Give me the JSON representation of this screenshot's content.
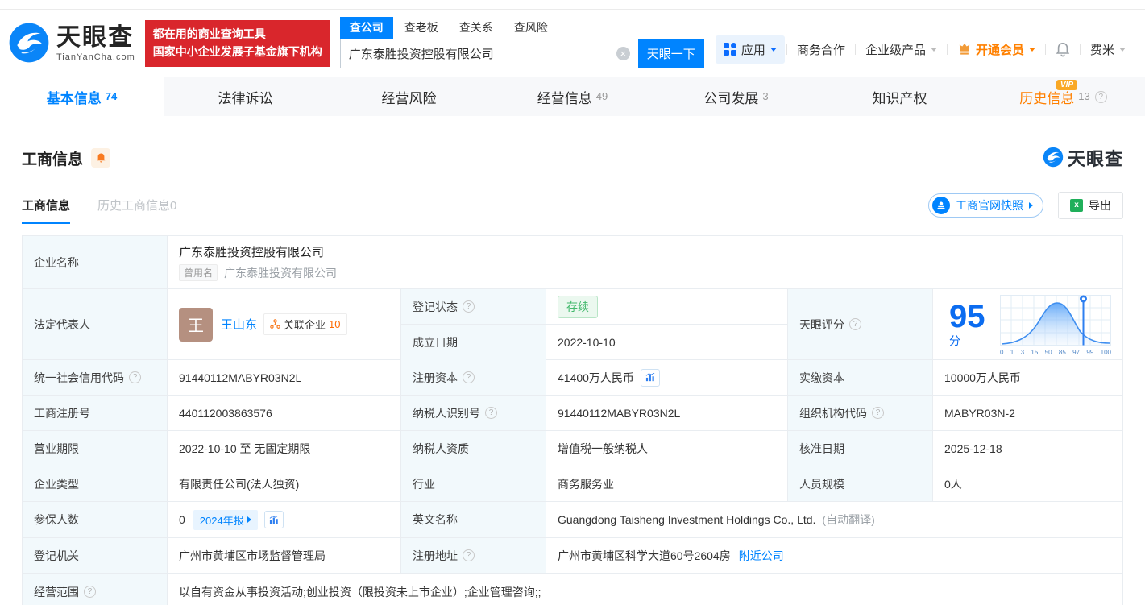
{
  "header": {
    "logo": {
      "title": "天眼查",
      "domain": "TianYanCha.com"
    },
    "slogan": {
      "line1": "都在用的商业查询工具",
      "line2": "国家中小企业发展子基金旗下机构"
    },
    "search": {
      "tabs": [
        {
          "label": "查公司"
        },
        {
          "label": "查老板"
        },
        {
          "label": "查关系"
        },
        {
          "label": "查风险"
        }
      ],
      "value": "广东泰胜投资控股有限公司",
      "button": "天眼一下"
    },
    "nav": {
      "apps": "应用",
      "cooperation": "商务合作",
      "enterprise_products": "企业级产品",
      "vip": "开通会员",
      "username": "费米"
    }
  },
  "tabs": {
    "items": [
      {
        "label": "基本信息",
        "count": "74"
      },
      {
        "label": "法律诉讼",
        "count": ""
      },
      {
        "label": "经营风险",
        "count": ""
      },
      {
        "label": "经营信息",
        "count": "49"
      },
      {
        "label": "公司发展",
        "count": "3"
      },
      {
        "label": "知识产权",
        "count": ""
      },
      {
        "label": "历史信息",
        "count": "13",
        "vip_badge": "VIP"
      }
    ]
  },
  "section": {
    "title": "工商信息",
    "subtab_active": "工商信息",
    "subtab_history": "历史工商信息0",
    "snapshot_button": "工商官网快照",
    "export_button": "导出",
    "excel_glyph": "x",
    "watermark": "天眼查"
  },
  "info": {
    "company_name": {
      "label": "企业名称",
      "value": "广东泰胜投资控股有限公司",
      "former_tag": "曾用名",
      "former_value": "广东泰胜投资有限公司"
    },
    "legal_rep": {
      "label": "法定代表人",
      "avatar_char": "王",
      "name": "王山东",
      "related_label": "关联企业",
      "related_count": "10"
    },
    "reg_status": {
      "label": "登记状态",
      "value": "存续"
    },
    "est_date": {
      "label": "成立日期",
      "value": "2022-10-10"
    },
    "score": {
      "label": "天眼评分",
      "value": "95",
      "unit": "分"
    },
    "credit_code": {
      "label": "统一社会信用代码",
      "value": "91440112MABYR03N2L"
    },
    "reg_capital": {
      "label": "注册资本",
      "value": "41400万人民币"
    },
    "paid_capital": {
      "label": "实缴资本",
      "value": "10000万人民币"
    },
    "reg_number": {
      "label": "工商注册号",
      "value": "440112003863576"
    },
    "taxpayer_id": {
      "label": "纳税人识别号",
      "value": "91440112MABYR03N2L"
    },
    "org_code": {
      "label": "组织机构代码",
      "value": "MABYR03N-2"
    },
    "business_term": {
      "label": "营业期限",
      "value": "2022-10-10 至 无固定期限"
    },
    "taxpayer_quality": {
      "label": "纳税人资质",
      "value": "增值税一般纳税人"
    },
    "approval_date": {
      "label": "核准日期",
      "value": "2025-12-18"
    },
    "company_type": {
      "label": "企业类型",
      "value": "有限责任公司(法人独资)"
    },
    "industry": {
      "label": "行业",
      "value": "商务服务业"
    },
    "staff_size": {
      "label": "人员规模",
      "value": "0人"
    },
    "insured_count": {
      "label": "参保人数",
      "value": "0",
      "report_badge": "2024年报"
    },
    "english_name": {
      "label": "英文名称",
      "value": "Guangdong Taisheng Investment Holdings Co., Ltd.",
      "note": "(自动翻译)"
    },
    "reg_authority": {
      "label": "登记机关",
      "value": "广州市黄埔区市场监督管理局"
    },
    "reg_address": {
      "label": "注册地址",
      "value": "广州市黄埔区科学大道60号2604房",
      "nearby_link": "附近公司"
    },
    "business_scope": {
      "label": "经营范围",
      "value": "以自有资金从事投资活动;创业投资（限投资未上市企业）;企业管理咨询;;"
    }
  },
  "chart_data": {
    "type": "area",
    "title": "天眼评分分布",
    "score": 95,
    "x_ticks": [
      "0",
      "1",
      "3",
      "15",
      "50",
      "85",
      "97",
      "99",
      "100"
    ],
    "marker_at_tick": "97",
    "curve_peak_tick": "50",
    "curve_relative_heights": [
      0.02,
      0.06,
      0.14,
      0.55,
      1.0,
      0.45,
      0.15,
      0.06,
      0.03
    ]
  },
  "colors": {
    "primary_blue": "#0084ff",
    "brand_red": "#d9262c",
    "vip_orange": "#ff8000",
    "status_green": "#44b96d",
    "link_blue": "#0084ff"
  }
}
